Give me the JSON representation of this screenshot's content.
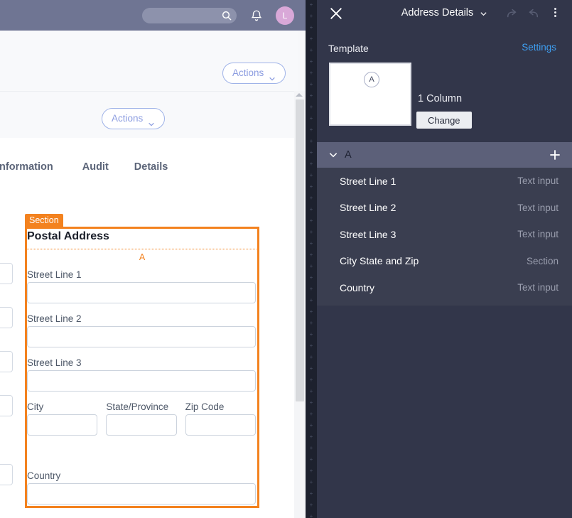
{
  "topbar": {
    "search_placeholder": "",
    "search_icon": "search-icon",
    "bell_icon": "notifications-bell-icon",
    "avatar_initial": "L"
  },
  "record": {
    "actions_label_1": "Actions",
    "actions_label_2": "Actions",
    "close_icon": "close-icon",
    "tabs": [
      {
        "label": "Information"
      },
      {
        "label": "Audit"
      },
      {
        "label": "Details"
      }
    ]
  },
  "section_editor": {
    "tag_label": "Section",
    "title": "Postal Address",
    "inner_marker": "A",
    "accent_color": "#f3821f",
    "fields": [
      {
        "label": "Street Line 1"
      },
      {
        "label": "Street Line 2"
      },
      {
        "label": "Street Line 3"
      }
    ],
    "address_row": [
      {
        "label": "City"
      },
      {
        "label": "State/Province"
      },
      {
        "label": "Zip Code"
      }
    ],
    "country": {
      "label": "Country"
    }
  },
  "panel": {
    "title": "Address Details",
    "close_icon": "close-icon",
    "redo_icon": "redo-icon",
    "undo_icon": "undo-icon",
    "kebab_icon": "more-options-icon",
    "template_label": "Template",
    "settings_label": "Settings",
    "thumbnail_marker": "A",
    "column_label": "1 Column",
    "change_label": "Change",
    "group": {
      "name": "A",
      "chevron_icon": "chevron-down-icon",
      "add_icon": "plus-icon"
    },
    "fields": [
      {
        "label": "Street Line 1",
        "type": "Text input"
      },
      {
        "label": "Street Line 2",
        "type": "Text input"
      },
      {
        "label": "Street Line 3",
        "type": "Text input"
      },
      {
        "label": "City State and Zip",
        "type": "Section"
      },
      {
        "label": "Country",
        "type": "Text input"
      }
    ]
  }
}
